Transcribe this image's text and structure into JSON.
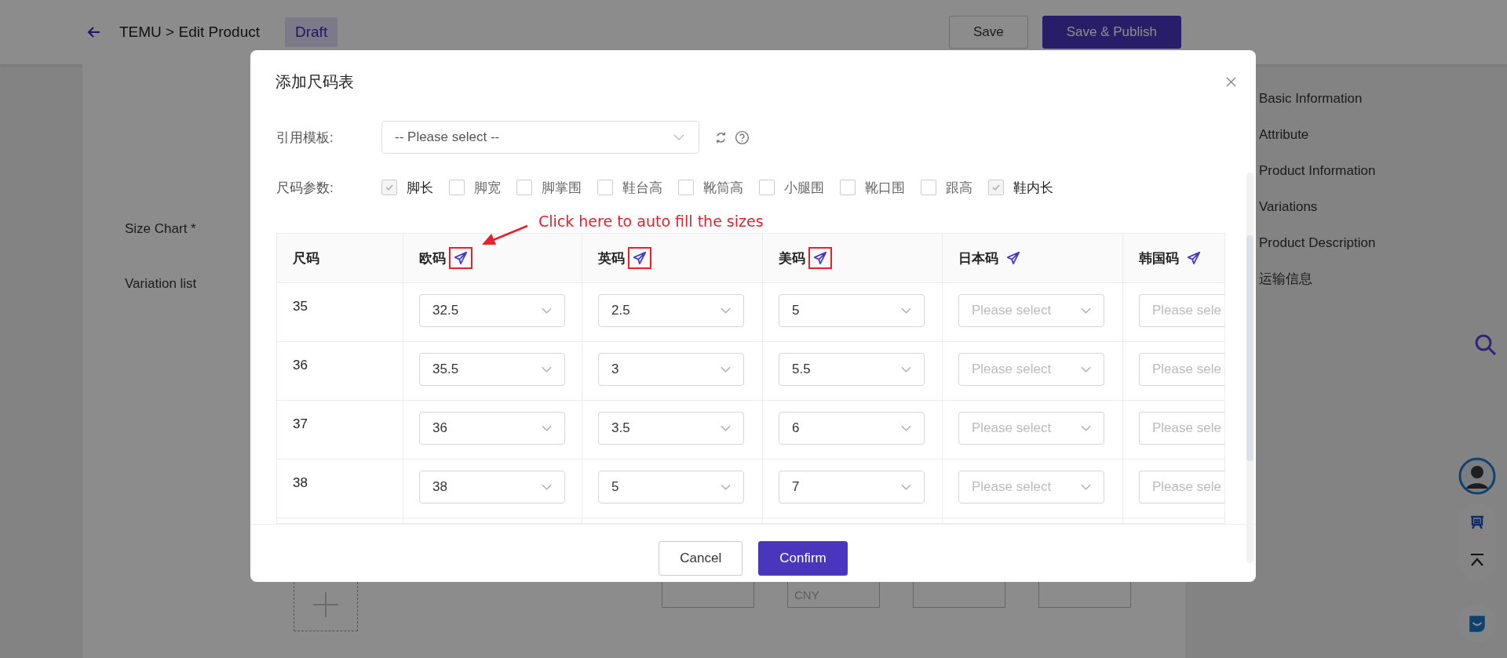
{
  "header": {
    "breadcrumb": "TEMU > Edit Product",
    "status": "Draft",
    "buttons": [
      {
        "label": "Save",
        "kind": "secondary"
      },
      {
        "label": "Save & Publish",
        "kind": "primary"
      }
    ]
  },
  "form": {
    "labels": [
      "Size Chart *",
      "Variation list"
    ],
    "price_placeholder": "CNY"
  },
  "nav": {
    "items": [
      "Basic Information",
      "Attribute",
      "Product Information",
      "Variations",
      "Product Description",
      "运输信息"
    ]
  },
  "modal": {
    "title": "添加尺码表",
    "template_label": "引用模板:",
    "template_placeholder": "-- Please select --",
    "params_label": "尺码参数:",
    "params": [
      {
        "label": "脚长",
        "checked": true
      },
      {
        "label": "脚宽",
        "checked": false
      },
      {
        "label": "脚掌围",
        "checked": false
      },
      {
        "label": "鞋台高",
        "checked": false
      },
      {
        "label": "靴筒高",
        "checked": false
      },
      {
        "label": "小腿围",
        "checked": false
      },
      {
        "label": "靴口围",
        "checked": false
      },
      {
        "label": "跟高",
        "checked": false
      },
      {
        "label": "鞋内长",
        "checked": true
      }
    ],
    "annotation": "Click here to auto fill the sizes",
    "columns": [
      {
        "label": "尺码",
        "autofill": false,
        "highlighted": false
      },
      {
        "label": "欧码",
        "autofill": true,
        "highlighted": true
      },
      {
        "label": "英码",
        "autofill": true,
        "highlighted": true
      },
      {
        "label": "美码",
        "autofill": true,
        "highlighted": true
      },
      {
        "label": "日本码",
        "autofill": true,
        "highlighted": false
      },
      {
        "label": "韩国码",
        "autofill": true,
        "highlighted": false
      }
    ],
    "rows": [
      {
        "cells": [
          {
            "kind": "text",
            "value": "35"
          },
          {
            "kind": "select",
            "value": "32.5"
          },
          {
            "kind": "select",
            "value": "2.5"
          },
          {
            "kind": "select",
            "value": "5"
          },
          {
            "kind": "select",
            "placeholder": "Please select"
          },
          {
            "kind": "select",
            "placeholder": "Please sele"
          }
        ]
      },
      {
        "cells": [
          {
            "kind": "text",
            "value": "36"
          },
          {
            "kind": "select",
            "value": "35.5"
          },
          {
            "kind": "select",
            "value": "3"
          },
          {
            "kind": "select",
            "value": "5.5"
          },
          {
            "kind": "select",
            "placeholder": "Please select"
          },
          {
            "kind": "select",
            "placeholder": "Please sele"
          }
        ]
      },
      {
        "cells": [
          {
            "kind": "text",
            "value": "37"
          },
          {
            "kind": "select",
            "value": "36"
          },
          {
            "kind": "select",
            "value": "3.5"
          },
          {
            "kind": "select",
            "value": "6"
          },
          {
            "kind": "select",
            "placeholder": "Please select"
          },
          {
            "kind": "select",
            "placeholder": "Please sele"
          }
        ]
      },
      {
        "cells": [
          {
            "kind": "text",
            "value": "38"
          },
          {
            "kind": "select",
            "value": "38"
          },
          {
            "kind": "select",
            "value": "5"
          },
          {
            "kind": "select",
            "value": "7"
          },
          {
            "kind": "select",
            "placeholder": "Please select"
          },
          {
            "kind": "select",
            "placeholder": "Please sele"
          }
        ]
      }
    ],
    "buttons": [
      {
        "label": "Cancel",
        "kind": "secondary"
      },
      {
        "label": "Confirm",
        "kind": "primary"
      }
    ]
  }
}
